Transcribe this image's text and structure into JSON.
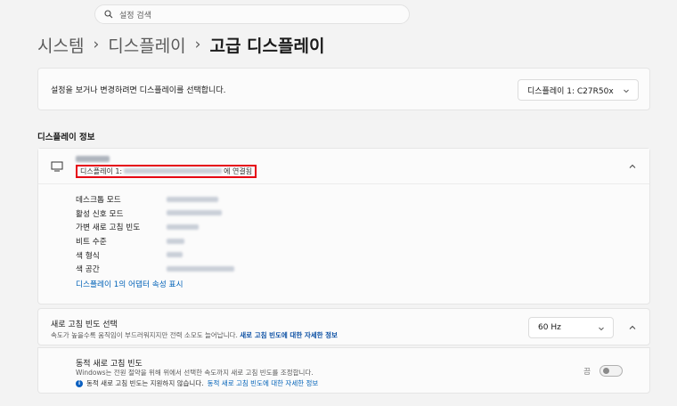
{
  "search": {
    "placeholder": "설정 검색"
  },
  "breadcrumb": {
    "items": [
      "시스템",
      "디스플레이"
    ],
    "separator": "›",
    "current": "고급 디스플레이"
  },
  "top_card": {
    "label": "설정을 보거나 변경하려면 디스플레이를 선택합니다.",
    "select_value": "디스플레이 1: C27R50x"
  },
  "section_title": "디스플레이 정보",
  "info": {
    "connected_prefix": "디스플레이 1:",
    "connected_suffix": "에 연결됨",
    "properties": [
      {
        "label": "데스크톱 모드"
      },
      {
        "label": "활성 신호 모드"
      },
      {
        "label": "가변 새로 고침 빈도"
      },
      {
        "label": "비트 수준"
      },
      {
        "label": "색 형식"
      },
      {
        "label": "색 공간"
      }
    ],
    "adapter_link": "디스플레이 1의 어댑터 속성 표시"
  },
  "refresh": {
    "title": "새로 고침 빈도 선택",
    "desc": "속도가 높을수록 움직임이 부드러워지지만 전력 소모도 늘어납니다.",
    "desc_link": "새로 고침 빈도에 대한 자세한 정보",
    "value": "60 Hz"
  },
  "dynamic": {
    "title": "동적 새로 고침 빈도",
    "desc": "Windows는 전원 절약을 위해 위에서 선택한 속도까지 새로 고침 빈도를 조정합니다.",
    "note": "동적 새로 고침 빈도는 지원하지 않습니다.",
    "note_link": "동적 새로 고침 빈도에 대한 자세한 정보",
    "toggle_state": "끔"
  },
  "colors": {
    "accent": "#0062b8",
    "highlight_box": "#e60012",
    "background": "#f3f3f3"
  }
}
